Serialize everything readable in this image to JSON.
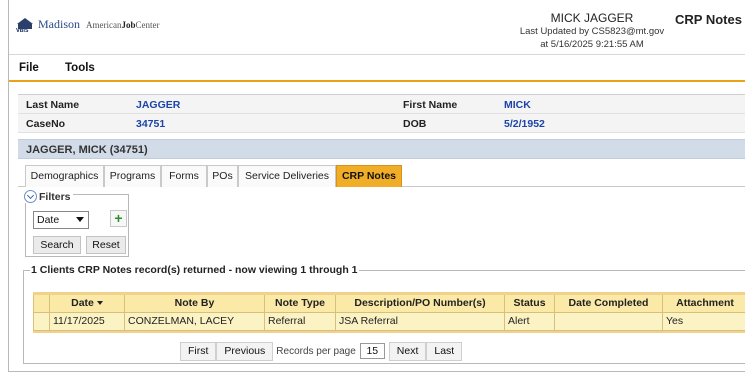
{
  "header": {
    "logo_brand": "Madison",
    "logo_mark_text": "VBIS",
    "logo_ajc_prefix": "American",
    "logo_ajc_bold": "Job",
    "logo_ajc_suffix": "Center",
    "client_name": "MICK JAGGER",
    "last_updated_line": "Last Updated by CS5823@mt.gov",
    "timestamp_line": "at 5/16/2025 9:21:55 AM",
    "page_title": "CRP Notes"
  },
  "menu": {
    "file": "File",
    "tools": "Tools"
  },
  "client_info": {
    "last_name_label": "Last Name",
    "last_name": "JAGGER",
    "first_name_label": "First Name",
    "first_name": "MICK",
    "case_no_label": "CaseNo",
    "case_no": "34751",
    "dob_label": "DOB",
    "dob": "5/2/1952",
    "summary": "JAGGER, MICK (34751)"
  },
  "tabs": [
    {
      "label": "Demographics",
      "active": false
    },
    {
      "label": "Programs",
      "active": false
    },
    {
      "label": "Forms",
      "active": false
    },
    {
      "label": "POs",
      "active": false
    },
    {
      "label": "Service Deliveries",
      "active": false
    },
    {
      "label": "CRP Notes",
      "active": true
    }
  ],
  "filters": {
    "legend": "Filters",
    "selected": "Date",
    "add_symbol": "+",
    "search_label": "Search",
    "reset_label": "Reset"
  },
  "results": {
    "legend": "1 Clients CRP Notes record(s) returned - now viewing 1 through 1",
    "columns": [
      "Date",
      "Note By",
      "Note Type",
      "Description/PO Number(s)",
      "Status",
      "Date Completed",
      "Attachment"
    ],
    "rows": [
      [
        "11/17/2025",
        "CONZELMAN, LACEY",
        "Referral",
        "JSA Referral",
        "Alert",
        "",
        "Yes"
      ]
    ]
  },
  "pager": {
    "first": "First",
    "previous": "Previous",
    "records_per_page_label": "Records per page",
    "records_per_page": "15",
    "next": "Next",
    "last": "Last"
  },
  "colors": {
    "accent_orange": "#f0ad28",
    "link_blue": "#1c44a8",
    "grid_header": "#fbe9a8",
    "grid_row": "#fcf3c4"
  }
}
